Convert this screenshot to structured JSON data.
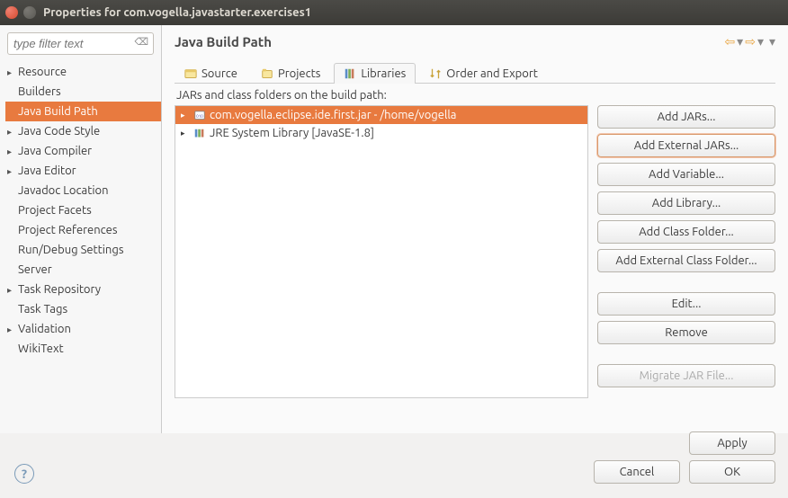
{
  "window": {
    "title": "Properties for com.vogella.javastarter.exercises1"
  },
  "sidebar": {
    "filter_placeholder": "type filter text",
    "items": [
      {
        "label": "Resource",
        "hasChildren": true
      },
      {
        "label": "Builders",
        "hasChildren": false
      },
      {
        "label": "Java Build Path",
        "hasChildren": false,
        "selected": true
      },
      {
        "label": "Java Code Style",
        "hasChildren": true
      },
      {
        "label": "Java Compiler",
        "hasChildren": true
      },
      {
        "label": "Java Editor",
        "hasChildren": true
      },
      {
        "label": "Javadoc Location",
        "hasChildren": false
      },
      {
        "label": "Project Facets",
        "hasChildren": false
      },
      {
        "label": "Project References",
        "hasChildren": false
      },
      {
        "label": "Run/Debug Settings",
        "hasChildren": false
      },
      {
        "label": "Server",
        "hasChildren": false
      },
      {
        "label": "Task Repository",
        "hasChildren": true
      },
      {
        "label": "Task Tags",
        "hasChildren": false
      },
      {
        "label": "Validation",
        "hasChildren": true
      },
      {
        "label": "WikiText",
        "hasChildren": false
      }
    ]
  },
  "main": {
    "title": "Java Build Path",
    "tabs": [
      {
        "label": "Source",
        "icon": "source"
      },
      {
        "label": "Projects",
        "icon": "projects"
      },
      {
        "label": "Libraries",
        "icon": "libraries",
        "active": true
      },
      {
        "label": "Order and Export",
        "icon": "order"
      }
    ],
    "subheader": "JARs and class folders on the build path:",
    "jars": [
      {
        "label": "com.vogella.eclipse.ide.first.jar - /home/vogella",
        "icon": "jar",
        "selected": true,
        "expandable": true
      },
      {
        "label": "JRE System Library [JavaSE-1.8]",
        "icon": "jre",
        "expandable": true
      }
    ],
    "buttons": {
      "add_jars": "Add JARs...",
      "add_ext_jars": "Add External JARs...",
      "add_variable": "Add Variable...",
      "add_library": "Add Library...",
      "add_class_folder": "Add Class Folder...",
      "add_ext_class_folder": "Add External Class Folder...",
      "edit": "Edit...",
      "remove": "Remove",
      "migrate": "Migrate JAR File..."
    }
  },
  "footer": {
    "apply": "Apply",
    "cancel": "Cancel",
    "ok": "OK"
  }
}
